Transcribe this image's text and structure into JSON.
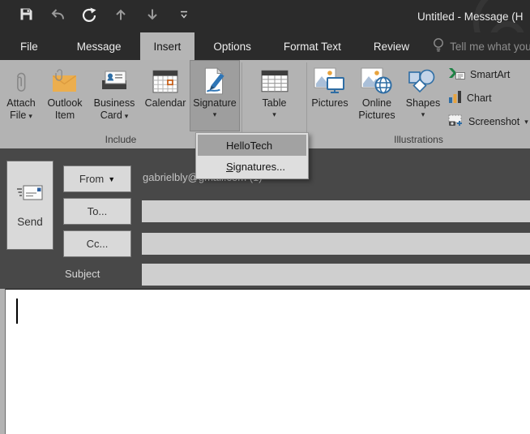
{
  "titlebar": {
    "title": "Untitled - Message (H"
  },
  "glyphs": {
    "caret_down": "▾",
    "caret_down_solid": "▼"
  },
  "tabs": {
    "file": "File",
    "message": "Message",
    "insert": "Insert",
    "options": "Options",
    "format_text": "Format Text",
    "review": "Review",
    "tell_me": "Tell me what you w"
  },
  "ribbon": {
    "include": {
      "label": "Include",
      "attach_file": {
        "line1": "Attach",
        "line2": "File"
      },
      "outlook_item": {
        "line1": "Outlook",
        "line2": "Item"
      },
      "business_card": {
        "line1": "Business",
        "line2": "Card"
      },
      "calendar": {
        "line1": "Calendar"
      },
      "signature": {
        "line1": "Signature"
      }
    },
    "tables": {
      "table": {
        "line1": "Table"
      }
    },
    "illustrations": {
      "label": "Illustrations",
      "pictures": {
        "line1": "Pictures"
      },
      "online_pictures": {
        "line1": "Online",
        "line2": "Pictures"
      },
      "shapes": {
        "line1": "Shapes"
      },
      "smartart": "SmartArt",
      "chart": "Chart",
      "screenshot": "Screenshot"
    }
  },
  "signature_menu": {
    "items": [
      {
        "label": "HelloTech",
        "highlighted": true
      },
      {
        "accel": "S",
        "rest": "ignatures...",
        "highlighted": false
      }
    ]
  },
  "compose": {
    "send": "Send",
    "from": "From",
    "from_value": "gabrielbly@gmail.com (1)",
    "to": "To...",
    "cc": "Cc...",
    "subject": "Subject"
  },
  "colors": {
    "titlebar_bg": "#2b2b2b",
    "ribbon_bg": "#b3b3b3",
    "pressed_button_bg": "#9e9e9e",
    "compose_bg": "#484848",
    "menu_highlight": "#a2a2a2",
    "accent_blue": "#2e6da4",
    "accent_orange": "#e8a33d",
    "body_bg": "#ffffff"
  }
}
